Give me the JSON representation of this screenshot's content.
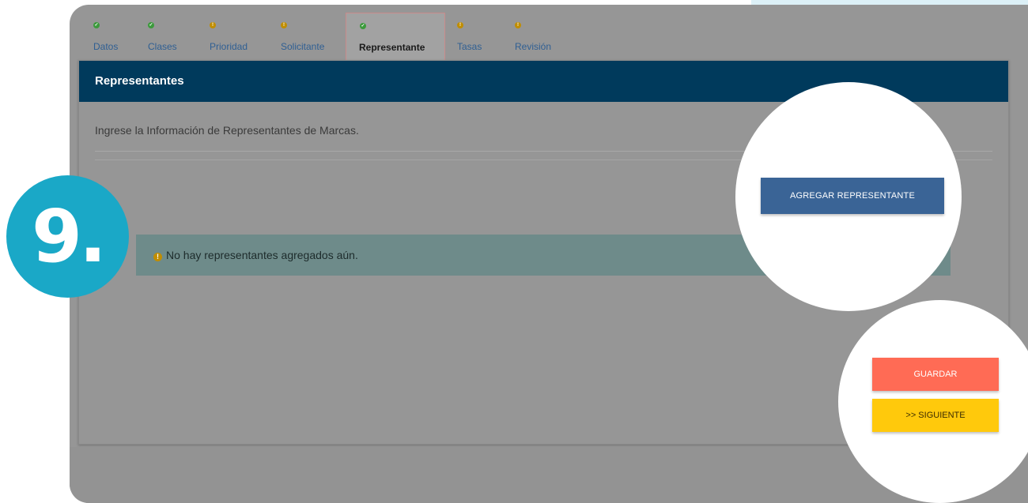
{
  "tabs": [
    {
      "label": "Datos",
      "status": "ok"
    },
    {
      "label": "Clases",
      "status": "ok"
    },
    {
      "label": "Prioridad",
      "status": "warn"
    },
    {
      "label": "Solicitante",
      "status": "warn"
    },
    {
      "label": "Representante",
      "status": "ok"
    },
    {
      "label": "Tasas",
      "status": "warn"
    },
    {
      "label": "Revisión",
      "status": "warn"
    }
  ],
  "active_tab": "Representante",
  "panel": {
    "title": "Representantes",
    "intro": "Ingrese la Información de Representantes de Marcas.",
    "empty_message": "No hay representantes agregados aún."
  },
  "buttons": {
    "add_representative": "AGREGAR REPRESENTANTE",
    "save": "GUARDAR",
    "next": ">> SIGUIENTE"
  },
  "step_badge": "9.",
  "colors": {
    "header": "#003a5c",
    "save": "#ff6b55",
    "next": "#ffc90c",
    "add": "#3a6496",
    "badge": "#1aa8c7"
  }
}
